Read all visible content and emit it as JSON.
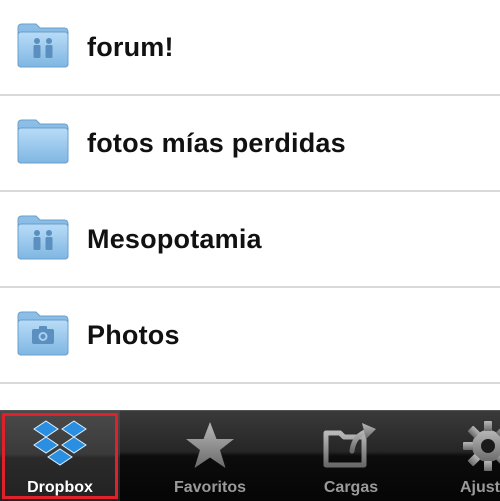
{
  "folders": [
    {
      "name": "forum!",
      "icon": "shared-folder-icon"
    },
    {
      "name": "fotos mías perdidas",
      "icon": "folder-icon"
    },
    {
      "name": "Mesopotamia",
      "icon": "shared-folder-icon"
    },
    {
      "name": "Photos",
      "icon": "camera-folder-icon"
    }
  ],
  "tabbar": {
    "tabs": [
      {
        "label": "Dropbox",
        "icon": "dropbox-logo-icon",
        "selected": true
      },
      {
        "label": "Favoritos",
        "icon": "star-icon",
        "selected": false
      },
      {
        "label": "Cargas",
        "icon": "upload-folder-icon",
        "selected": false
      },
      {
        "label": "Ajustes",
        "icon": "gear-icon",
        "selected": false
      }
    ]
  },
  "colors": {
    "folder": "#9cc8ec",
    "tab_active_text": "#ffffff",
    "tab_inactive_text": "#9a9a9a",
    "highlight": "#e0202a",
    "dropbox_blue": "#2a8fe0"
  }
}
